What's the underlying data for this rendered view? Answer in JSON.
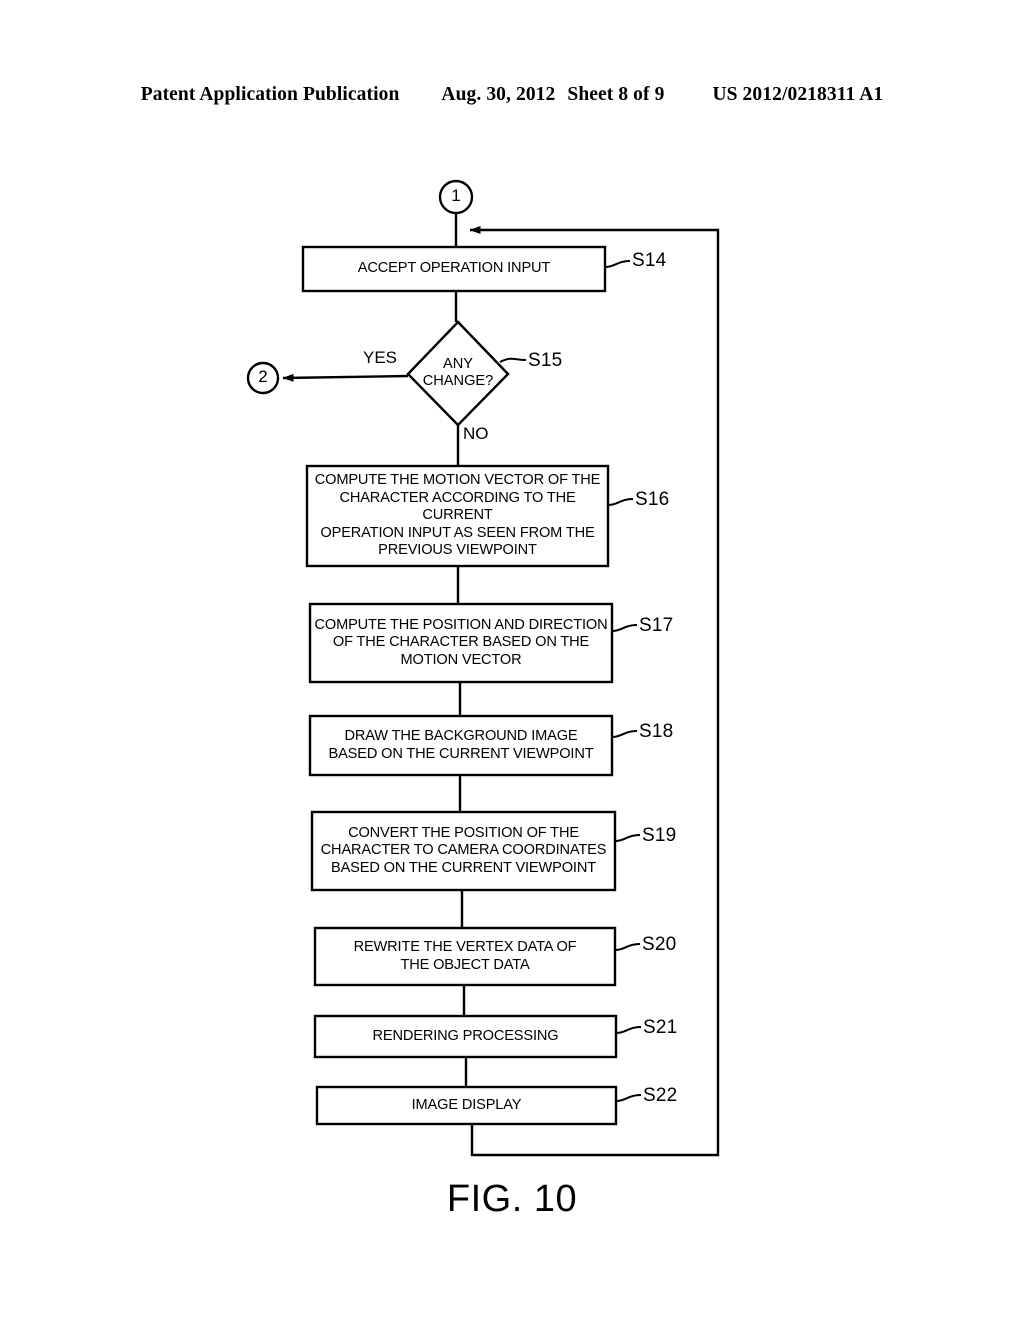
{
  "header": {
    "publication": "Patent Application Publication",
    "date": "Aug. 30, 2012",
    "sheet": "Sheet 8 of 9",
    "number": "US 2012/0218311 A1"
  },
  "figure": {
    "caption": "FIG. 10"
  },
  "connectors": [
    {
      "id": "connector-1",
      "label": "1"
    },
    {
      "id": "connector-2",
      "label": "2"
    }
  ],
  "branches": {
    "yes": "YES",
    "no": "NO"
  },
  "nodes": [
    {
      "id": "s14",
      "step": "S14",
      "shape": "process",
      "text": "ACCEPT OPERATION INPUT"
    },
    {
      "id": "s15",
      "step": "S15",
      "shape": "decision",
      "text": "ANY\nCHANGE?"
    },
    {
      "id": "s16",
      "step": "S16",
      "shape": "process",
      "text": "COMPUTE THE MOTION VECTOR OF THE\nCHARACTER ACCORDING TO THE CURRENT\nOPERATION INPUT AS SEEN FROM THE\nPREVIOUS VIEWPOINT"
    },
    {
      "id": "s17",
      "step": "S17",
      "shape": "process",
      "text": "COMPUTE THE POSITION AND DIRECTION\nOF THE CHARACTER BASED ON THE\nMOTION VECTOR"
    },
    {
      "id": "s18",
      "step": "S18",
      "shape": "process",
      "text": "DRAW THE BACKGROUND IMAGE\nBASED ON THE CURRENT VIEWPOINT"
    },
    {
      "id": "s19",
      "step": "S19",
      "shape": "process",
      "text": "CONVERT THE POSITION OF THE\nCHARACTER TO CAMERA COORDINATES\nBASED ON THE CURRENT VIEWPOINT"
    },
    {
      "id": "s20",
      "step": "S20",
      "shape": "process",
      "text": "REWRITE THE VERTEX DATA OF\nTHE OBJECT DATA"
    },
    {
      "id": "s21",
      "step": "S21",
      "shape": "process",
      "text": "RENDERING PROCESSING"
    },
    {
      "id": "s22",
      "step": "S22",
      "shape": "process",
      "text": "IMAGE DISPLAY"
    }
  ],
  "colors": {
    "ink": "#000000",
    "paper": "#ffffff"
  }
}
